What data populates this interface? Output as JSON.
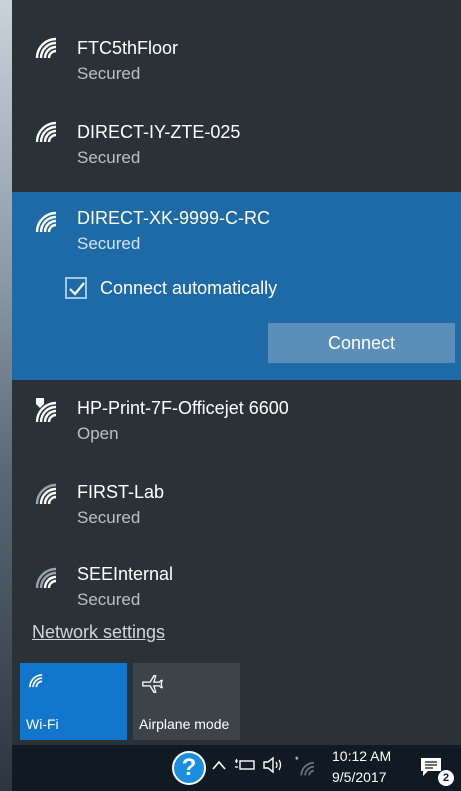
{
  "networks": [
    {
      "ssid": "FTC5thFloor",
      "status": "Secured"
    },
    {
      "ssid": "DIRECT-IY-ZTE-025",
      "status": "Secured"
    },
    {
      "ssid": "DIRECT-XK-9999-C-RC",
      "status": "Secured"
    },
    {
      "ssid": "HP-Print-7F-Officejet 6600",
      "status": "Open"
    },
    {
      "ssid": "FIRST-Lab",
      "status": "Secured"
    },
    {
      "ssid": "SEEInternal",
      "status": "Secured"
    }
  ],
  "selected": {
    "connect_automatically_label": "Connect automatically",
    "connect_automatically_checked": true,
    "connect_button": "Connect"
  },
  "network_settings": "Network settings",
  "quick_actions": [
    {
      "label": "Wi-Fi",
      "icon": "wifi-icon",
      "active": true
    },
    {
      "label": "Airplane mode",
      "icon": "airplane-icon",
      "active": false
    }
  ],
  "taskbar": {
    "help_icon": "?",
    "time": "10:12 AM",
    "date": "9/5/2017",
    "notification_count": "2"
  },
  "colors": {
    "panel": "#2b3237",
    "selected": "#1e6aa7",
    "accent": "#1176cc",
    "button": "#5b8eb8",
    "taskbar": "#101a24"
  }
}
